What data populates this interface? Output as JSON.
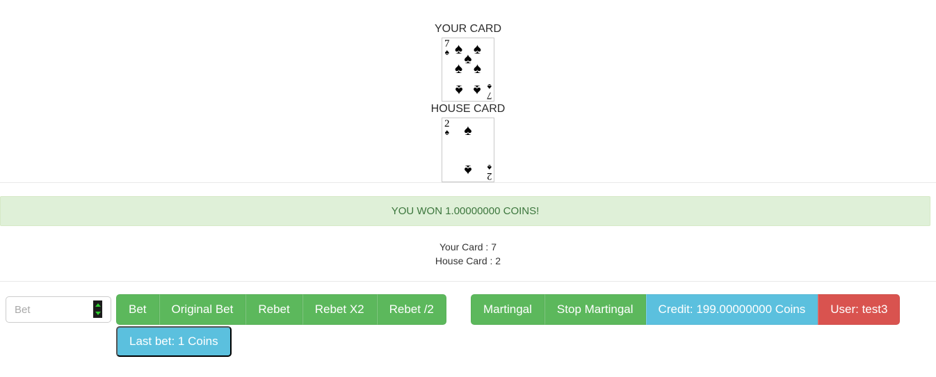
{
  "cards": {
    "your_card_label": "YOUR CARD",
    "house_card_label": "HOUSE CARD",
    "your_card": {
      "rank": "7",
      "suit_glyph": "♠",
      "suit_name": "spades",
      "pip_count": 7
    },
    "house_card": {
      "rank": "2",
      "suit_glyph": "♠",
      "suit_name": "spades",
      "pip_count": 2
    }
  },
  "alert": {
    "message": "YOU WON 1.00000000 COINS!",
    "bg_color": "#dff0d8",
    "text_color": "#3c763d"
  },
  "results": {
    "your_card_line": "Your Card : 7",
    "house_card_line": "House Card : 2"
  },
  "bet_input": {
    "placeholder": "Bet",
    "value": "",
    "spinner_up": "spinner-up-arrow",
    "spinner_down": "spinner-down-arrow"
  },
  "bet_buttons": [
    {
      "label": "Bet"
    },
    {
      "label": "Original Bet"
    },
    {
      "label": "Rebet"
    },
    {
      "label": "Rebet X2"
    },
    {
      "label": "Rebet /2"
    }
  ],
  "status_buttons": [
    {
      "label": "Martingal",
      "style": "success"
    },
    {
      "label": "Stop Martingal",
      "style": "success"
    },
    {
      "label": "Credit: 199.00000000 Coins",
      "style": "info"
    },
    {
      "label": "User: test3",
      "style": "danger"
    }
  ],
  "last_bet": {
    "label": "Last bet: 1 Coins"
  },
  "colors": {
    "success": "#5cb85c",
    "info": "#5bc0de",
    "danger": "#d9534f",
    "alert_bg": "#dff0d8",
    "alert_text": "#3c763d"
  }
}
